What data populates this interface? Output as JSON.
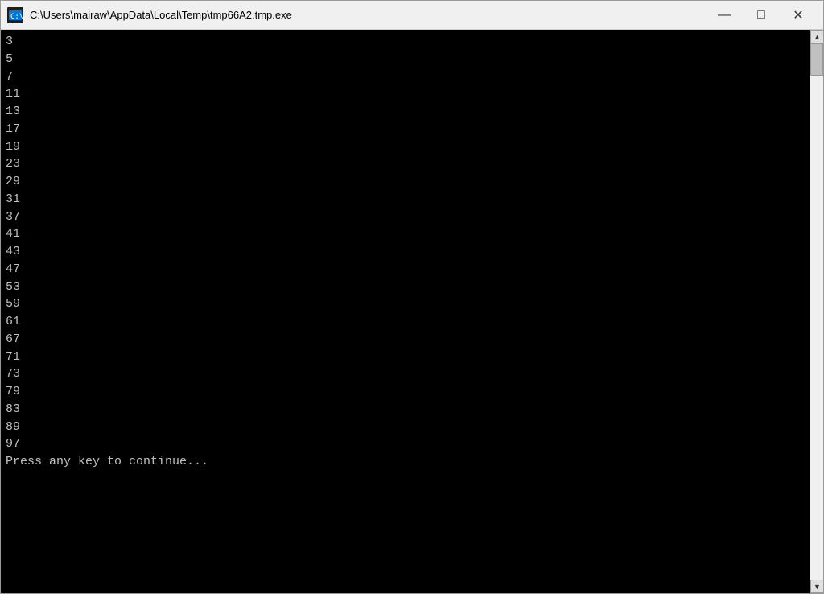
{
  "window": {
    "title": "C:\\Users\\mairaw\\AppData\\Local\\Temp\\tmp66A2.tmp.exe",
    "minimize_label": "—",
    "maximize_label": "□",
    "close_label": "✕"
  },
  "console": {
    "lines": [
      "3",
      "5",
      "7",
      "11",
      "13",
      "17",
      "19",
      "23",
      "29",
      "31",
      "37",
      "41",
      "43",
      "47",
      "53",
      "59",
      "61",
      "67",
      "71",
      "73",
      "79",
      "83",
      "89",
      "97",
      "Press any key to continue..."
    ]
  }
}
